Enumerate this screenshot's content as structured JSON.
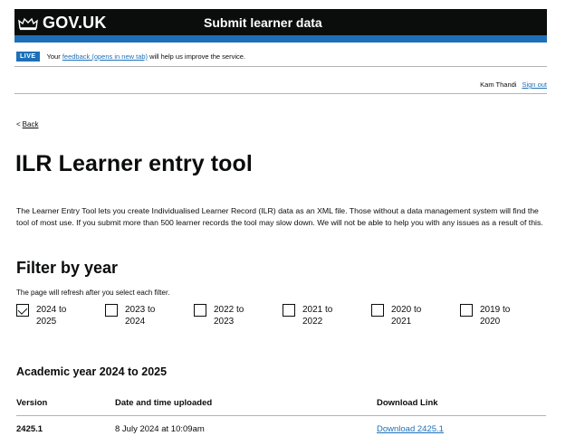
{
  "header": {
    "logo_text": "GOV.UK",
    "service_name": "Submit learner data",
    "colors": {
      "background": "#0b0c0c",
      "stripe": "#1d70b8"
    }
  },
  "phase_banner": {
    "tag": "LIVE",
    "text_before": "Your ",
    "link_text": "feedback (opens in new tab)",
    "text_after": " will help us improve the service."
  },
  "account": {
    "user_name": "Kam Thandi",
    "sign_out": "Sign out"
  },
  "back_link": {
    "chevron": "<",
    "label": "Back"
  },
  "page_title": "ILR Learner entry tool",
  "intro_text": "The Learner Entry Tool lets you create Individualised Learner Record (ILR) data as an XML file. Those without a data management system will find the tool of most use. If you submit more than 500 learner records the tool may slow down. We will not be able to help you with any issues as a result of this.",
  "filter": {
    "title": "Filter by year",
    "hint": "The page will refresh after you select each filter.",
    "options": [
      {
        "label": "2024 to 2025",
        "checked": true
      },
      {
        "label": "2023 to 2024",
        "checked": false
      },
      {
        "label": "2022 to 2023",
        "checked": false
      },
      {
        "label": "2021 to 2022",
        "checked": false
      },
      {
        "label": "2020 to 2021",
        "checked": false
      },
      {
        "label": "2019 to 2020",
        "checked": false
      }
    ]
  },
  "results": {
    "title": "Academic year 2024 to 2025",
    "columns": [
      "Version",
      "Date and time uploaded",
      "Download Link"
    ],
    "rows": [
      {
        "version": "2425.1",
        "uploaded": "8 July 2024 at 10:09am",
        "link": "Download 2425.1"
      }
    ]
  },
  "colors": {
    "link": "#1d70b8",
    "text": "#0b0c0c",
    "border": "#b1b4b6"
  }
}
